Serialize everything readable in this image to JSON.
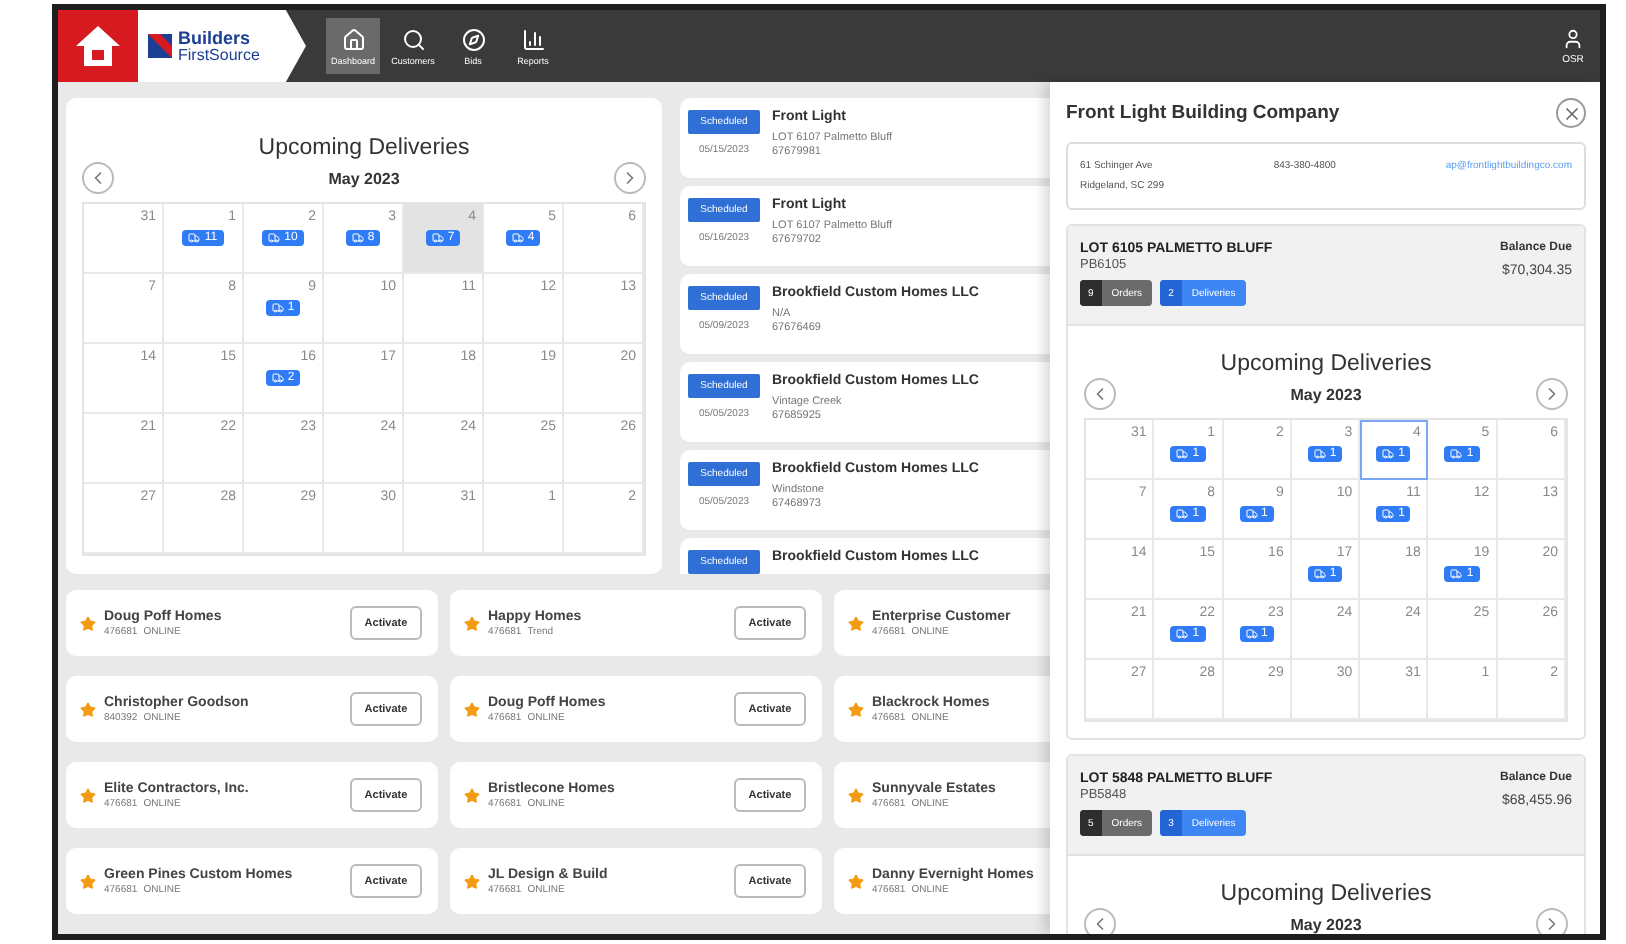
{
  "header": {
    "brand": [
      "Builders",
      "FirstSource"
    ],
    "nav": [
      {
        "label": "Dashboard",
        "selected": true
      },
      {
        "label": "Customers",
        "selected": false
      },
      {
        "label": "Bids",
        "selected": false
      },
      {
        "label": "Reports",
        "selected": false
      }
    ],
    "user": "OSR"
  },
  "calendar": {
    "title": "Upcoming Deliveries",
    "month": "May 2023",
    "weeks": [
      [
        {
          "day": "31",
          "selected": false
        },
        {
          "day": "1",
          "count": "11",
          "selected": false
        },
        {
          "day": "2",
          "count": "10",
          "selected": false
        },
        {
          "day": "3",
          "count": "8",
          "selected": false
        },
        {
          "day": "4",
          "count": "7",
          "selected": true
        },
        {
          "day": "5",
          "count": "4",
          "selected": false
        },
        {
          "day": "6",
          "selected": false
        }
      ],
      [
        {
          "day": "7",
          "selected": false
        },
        {
          "day": "8",
          "selected": false
        },
        {
          "day": "9",
          "count": "1",
          "selected": false
        },
        {
          "day": "10",
          "selected": false
        },
        {
          "day": "11",
          "selected": false
        },
        {
          "day": "12",
          "selected": false
        },
        {
          "day": "13",
          "selected": false
        }
      ],
      [
        {
          "day": "14",
          "selected": false
        },
        {
          "day": "15",
          "selected": false
        },
        {
          "day": "16",
          "count": "2",
          "selected": false
        },
        {
          "day": "17",
          "selected": false
        },
        {
          "day": "18",
          "selected": false
        },
        {
          "day": "19",
          "selected": false
        },
        {
          "day": "20",
          "selected": false
        }
      ],
      [
        {
          "day": "21",
          "selected": false
        },
        {
          "day": "22",
          "selected": false
        },
        {
          "day": "23",
          "selected": false
        },
        {
          "day": "24",
          "selected": false
        },
        {
          "day": "24",
          "selected": false
        },
        {
          "day": "25",
          "selected": false
        },
        {
          "day": "26",
          "selected": false
        }
      ],
      [
        {
          "day": "27",
          "selected": false
        },
        {
          "day": "28",
          "selected": false
        },
        {
          "day": "29",
          "selected": false
        },
        {
          "day": "30",
          "selected": false
        },
        {
          "day": "31",
          "selected": false
        },
        {
          "day": "1",
          "selected": false
        },
        {
          "day": "2",
          "selected": false
        }
      ]
    ]
  },
  "deliveries": [
    {
      "status": "Scheduled",
      "date": "05/15/2023",
      "customer": "Front Light",
      "address": "LOT 6107 Palmetto Bluff",
      "number": "67679981"
    },
    {
      "status": "Scheduled",
      "date": "05/16/2023",
      "customer": "Front Light",
      "address": "LOT 6107 Palmetto Bluff",
      "number": "67679702"
    },
    {
      "status": "Scheduled",
      "date": "05/09/2023",
      "customer": "Brookfield Custom Homes LLC",
      "address": "N/A",
      "number": "67676469"
    },
    {
      "status": "Scheduled",
      "date": "05/05/2023",
      "customer": "Brookfield Custom Homes LLC",
      "address": "Vintage Creek",
      "number": "67685925"
    },
    {
      "status": "Scheduled",
      "date": "05/05/2023",
      "customer": "Brookfield Custom Homes LLC",
      "address": "Windstone",
      "number": "67468973"
    },
    {
      "status": "Scheduled",
      "customer": "Brookfield Custom Homes LLC"
    }
  ],
  "customers": [
    {
      "name": "Doug Poff Homes",
      "number": "476681",
      "channel": "ONLINE",
      "starred": true,
      "action": "Activate"
    },
    {
      "name": "Happy Homes",
      "number": "476681",
      "channel": "Trend",
      "starred": true,
      "action": "Activate"
    },
    {
      "name": "Enterprise Customer",
      "number": "476681",
      "channel": "ONLINE",
      "starred": true
    },
    {
      "name": "Christopher Goodson",
      "number": "840392",
      "channel": "ONLINE",
      "starred": true,
      "action": "Activate"
    },
    {
      "name": "Doug Poff Homes",
      "number": "476681",
      "channel": "ONLINE",
      "starred": true,
      "action": "Activate"
    },
    {
      "name": "Blackrock Homes",
      "number": "476681",
      "channel": "ONLINE",
      "starred": true
    },
    {
      "name": "Elite Contractors, Inc.",
      "number": "476681",
      "channel": "ONLINE",
      "starred": true,
      "action": "Activate"
    },
    {
      "name": "Bristlecone Homes",
      "number": "476681",
      "channel": "ONLINE",
      "starred": true,
      "action": "Activate"
    },
    {
      "name": "Sunnyvale Estates",
      "number": "476681",
      "channel": "ONLINE",
      "starred": true
    },
    {
      "name": "Green Pines Custom Homes",
      "number": "476681",
      "channel": "ONLINE",
      "starred": true,
      "action": "Activate"
    },
    {
      "name": "JL Design & Build",
      "number": "476681",
      "channel": "ONLINE",
      "starred": true,
      "action": "Activate"
    },
    {
      "name": "Danny Evernight Homes",
      "number": "476681",
      "channel": "ONLINE",
      "starred": true
    }
  ],
  "drawer": {
    "title": "Front Light Building Company",
    "contact": {
      "address": [
        "61 Schinger Ave",
        "Ridgeland, SC 299"
      ],
      "phone": "843-380-4800",
      "email": "ap@frontlightbuildingco.com"
    },
    "lots": [
      {
        "name": "LOT 6105 PALMETTO BLUFF",
        "code": "PB6105",
        "orders": {
          "count": "9",
          "label": "Orders"
        },
        "deliveries": {
          "count": "2",
          "label": "Deliveries"
        },
        "balance_label": "Balance Due",
        "balance": "$70,304.35",
        "calendar": {
          "title": "Upcoming Deliveries",
          "month": "May 2023",
          "weeks": [
            [
              {
                "day": "31",
                "selected": false
              },
              {
                "day": "1",
                "count": "1",
                "selected": false
              },
              {
                "day": "2",
                "selected": false
              },
              {
                "day": "3",
                "count": "1",
                "selected": false
              },
              {
                "day": "4",
                "count": "1",
                "selected": true
              },
              {
                "day": "5",
                "count": "1",
                "selected": false
              },
              {
                "day": "6",
                "selected": false
              }
            ],
            [
              {
                "day": "7",
                "selected": false
              },
              {
                "day": "8",
                "count": "1",
                "selected": false
              },
              {
                "day": "9",
                "count": "1",
                "selected": false
              },
              {
                "day": "10",
                "selected": false
              },
              {
                "day": "11",
                "count": "1",
                "selected": false
              },
              {
                "day": "12",
                "selected": false
              },
              {
                "day": "13",
                "selected": false
              }
            ],
            [
              {
                "day": "14",
                "selected": false
              },
              {
                "day": "15",
                "selected": false
              },
              {
                "day": "16",
                "selected": false
              },
              {
                "day": "17",
                "count": "1",
                "selected": false
              },
              {
                "day": "18",
                "selected": false
              },
              {
                "day": "19",
                "count": "1",
                "selected": false
              },
              {
                "day": "20",
                "selected": false
              }
            ],
            [
              {
                "day": "21",
                "selected": false
              },
              {
                "day": "22",
                "count": "1",
                "selected": false
              },
              {
                "day": "23",
                "count": "1",
                "selected": false
              },
              {
                "day": "24",
                "selected": false
              },
              {
                "day": "24",
                "selected": false
              },
              {
                "day": "25",
                "selected": false
              },
              {
                "day": "26",
                "selected": false
              }
            ],
            [
              {
                "day": "27",
                "selected": false
              },
              {
                "day": "28",
                "selected": false
              },
              {
                "day": "29",
                "selected": false
              },
              {
                "day": "30",
                "selected": false
              },
              {
                "day": "31",
                "selected": false
              },
              {
                "day": "1",
                "selected": false
              },
              {
                "day": "2",
                "selected": false
              }
            ]
          ]
        }
      },
      {
        "name": "LOT 5848 PALMETTO BLUFF",
        "code": "PB5848",
        "orders": {
          "count": "5",
          "label": "Orders"
        },
        "deliveries": {
          "count": "3",
          "label": "Deliveries"
        },
        "balance_label": "Balance Due",
        "balance": "$68,455.96",
        "calendar": {
          "title": "Upcoming Deliveries",
          "month": "May 2023"
        }
      }
    ]
  }
}
